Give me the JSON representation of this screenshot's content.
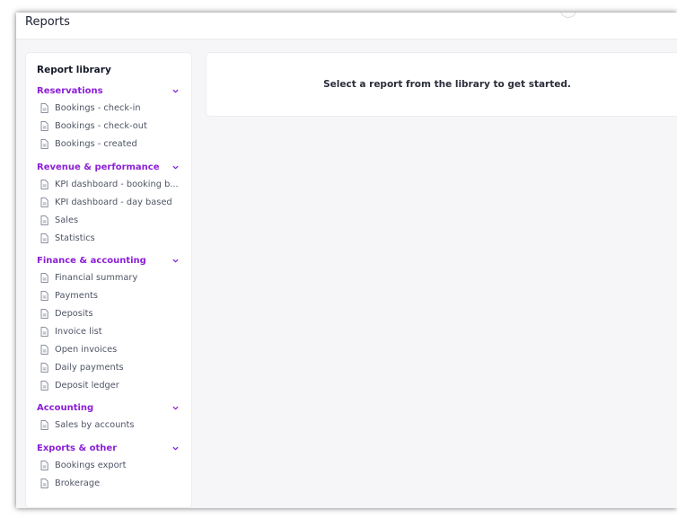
{
  "header": {
    "title": "Reports"
  },
  "main": {
    "empty_message": "Select a report from the library to get started."
  },
  "library": {
    "title": "Report library",
    "sections": [
      {
        "label": "Reservations",
        "items": [
          "Bookings - check-in",
          "Bookings - check-out",
          "Bookings - created"
        ]
      },
      {
        "label": "Revenue & performance",
        "items": [
          "KPI dashboard - booking b...",
          "KPI dashboard - day based",
          "Sales",
          "Statistics"
        ]
      },
      {
        "label": "Finance & accounting",
        "items": [
          "Financial summary",
          "Payments",
          "Deposits",
          "Invoice list",
          "Open invoices",
          "Daily payments",
          "Deposit ledger"
        ]
      },
      {
        "label": "Accounting",
        "items": [
          "Sales by accounts"
        ]
      },
      {
        "label": "Exports & other",
        "items": [
          "Bookings export",
          "Brokerage"
        ]
      }
    ]
  },
  "colors": {
    "accent": "#8c1fd6",
    "page_bg": "#f6f6f8",
    "card_bg": "#ffffff"
  },
  "icons": {
    "section_toggle": "chevron-down-icon",
    "report_item": "document-icon"
  }
}
